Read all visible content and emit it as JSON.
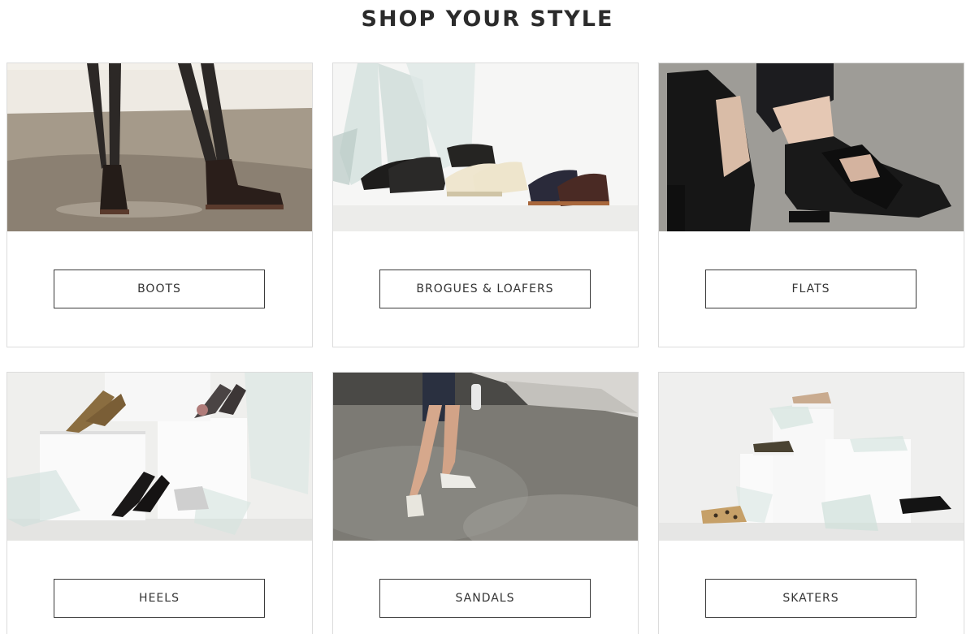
{
  "page": {
    "title": "SHOP YOUR STYLE"
  },
  "categories": [
    {
      "label": "BOOTS",
      "image": "woman-wearing-black-chelsea-boots"
    },
    {
      "label": "BROGUES & LOAFERS",
      "image": "brogues-and-tassel-loafers-with-glass"
    },
    {
      "label": "FLATS",
      "image": "black-cross-strap-flat-shoes"
    },
    {
      "label": "HEELS",
      "image": "pointed-heels-on-white-blocks"
    },
    {
      "label": "SANDALS",
      "image": "woman-wearing-white-slide-sandals"
    },
    {
      "label": "SKATERS",
      "image": "skater-shoes-on-white-blocks"
    }
  ]
}
